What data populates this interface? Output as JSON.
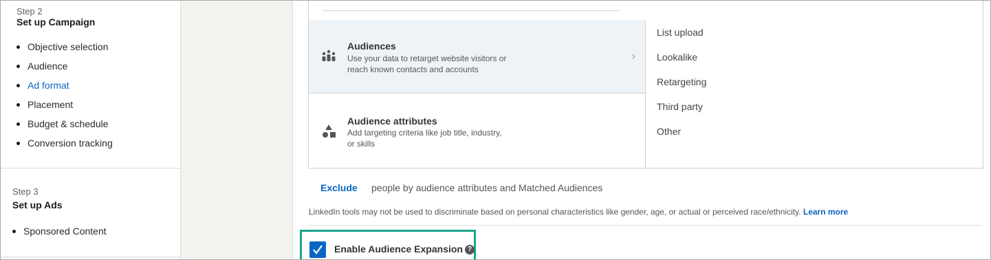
{
  "steps": {
    "step2": {
      "label": "Step 2",
      "title": "Set up Campaign",
      "items": [
        {
          "label": "Objective selection",
          "active": false
        },
        {
          "label": "Audience",
          "active": false
        },
        {
          "label": "Ad format",
          "active": true
        },
        {
          "label": "Placement",
          "active": false
        },
        {
          "label": "Budget & schedule",
          "active": false
        },
        {
          "label": "Conversion tracking",
          "active": false
        }
      ]
    },
    "step3": {
      "label": "Step 3",
      "title": "Set up Ads",
      "items": [
        {
          "label": "Sponsored Content",
          "active": false
        }
      ]
    }
  },
  "targeting": {
    "audiences": {
      "title": "Audiences",
      "desc_line1": "Use your data to retarget website visitors or",
      "desc_line2": "reach known contacts and accounts",
      "icon": "people-icon",
      "chevron": "›"
    },
    "attributes": {
      "title": "Audience attributes",
      "desc_line1": "Add targeting criteria like job title, industry,",
      "desc_line2": "or skills",
      "icon": "shapes-icon"
    },
    "sub_options": [
      "List upload",
      "Lookalike",
      "Retargeting",
      "Third party",
      "Other"
    ]
  },
  "exclude": {
    "link": "Exclude",
    "text": "people by audience attributes and Matched Audiences"
  },
  "notice": {
    "text": "LinkedIn tools may not be used to discriminate based on personal characteristics like gender, age, or actual or perceived race/ethnicity.",
    "link": "Learn more"
  },
  "expansion": {
    "label": "Enable Audience Expansion",
    "checked": true,
    "help": "?"
  },
  "colors": {
    "accent": "#0a66c2",
    "highlight_border": "#17a68c",
    "selected_bg": "#eef3f8"
  }
}
